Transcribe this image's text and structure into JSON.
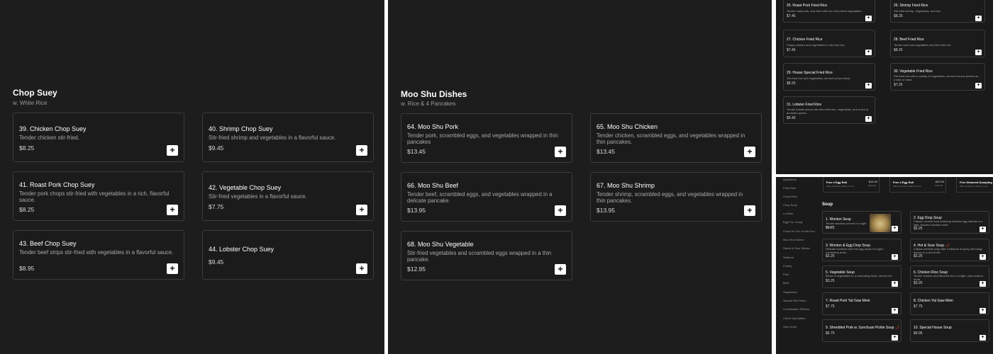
{
  "chop_suey": {
    "title": "Chop Suey",
    "subtitle": "w. White Rice",
    "items": [
      {
        "name": "39. Chicken Chop Suey",
        "desc": "Tender chicken stir-fried.",
        "price": "$8.25"
      },
      {
        "name": "40. Shrimp Chop Suey",
        "desc": "Stir-fried shrimp and vegetables in a flavorful sauce.",
        "price": "$9.45"
      },
      {
        "name": "41. Roast Pork Chop Suey",
        "desc": "Tender pork chops stir-fried with vegetables in a rich, flavorful sauce.",
        "price": "$8.25"
      },
      {
        "name": "42. Vegetable Chop Suey",
        "desc": "Stir-fried vegetables in a flavorful sauce.",
        "price": "$7.75"
      },
      {
        "name": "43. Beef Chop Suey",
        "desc": "Tender beef strips stir-fried with vegetables in a flavorful sauce.",
        "price": "$8.95"
      },
      {
        "name": "44. Lobster Chop Suey",
        "desc": "",
        "price": "$9.45"
      }
    ]
  },
  "moo_shu": {
    "title": "Moo Shu Dishes",
    "subtitle": "w. Rice & 4 Pancakes",
    "items": [
      {
        "name": "64. Moo Shu Pork",
        "desc": "Tender pork, scrambled eggs, and vegetables wrapped in thin pancakes",
        "price": "$13.45"
      },
      {
        "name": "65. Moo Shu Chicken",
        "desc": "Tender chicken, scrambled eggs, and vegetables wrapped in thin pancakes.",
        "price": "$13.45"
      },
      {
        "name": "66. Moo Shu Beef",
        "desc": "Tender beef, scrambled eggs, and vegetables wrapped in a delicate pancake.",
        "price": "$13.95"
      },
      {
        "name": "67. Moo Shu Shrimp",
        "desc": "Tender shrimp, scrambled eggs, and vegetables wrapped in thin pancakes.",
        "price": "$13.95"
      },
      {
        "name": "68. Moo Shu Vegetable",
        "desc": "Stir-fried vegetables and scrambled eggs wrapped in a thin pancake.",
        "price": "$12.95"
      }
    ]
  },
  "fried_rice": {
    "items": [
      {
        "name": "25. Roast Pork Fried Rice",
        "desc": "Tender roast pork, wok-fried with rice and mixed vegetables.",
        "price": "$7.45"
      },
      {
        "name": "26. Shrimp Fried Rice",
        "desc": "Stir-fried shrimp, vegetables, and rice",
        "price": "$8.25"
      },
      {
        "name": "27. Chicken Fried Rice",
        "desc": "Crispy chicken and vegetables in stir-fried rice.",
        "price": "$7.45"
      },
      {
        "name": "28. Beef Fried Rice",
        "desc": "Tender beef and vegetables stir-fried with rice",
        "price": "$8.25"
      },
      {
        "name": "29. House Special Fried Rice",
        "desc": "Stir-fried rice and vegetables, served hot and fresh.",
        "price": "$8.25"
      },
      {
        "name": "30. Vegetable Fried Rice",
        "desc": "Stir-fried rice with a variety of vegetables, served hot and perfect as a side or meal.",
        "price": "$7.25"
      },
      {
        "name": "31. Lobster Fried Rice",
        "desc": "Tender lobster pieces stir-fried with rice, vegetables, and a hint of aromatic spices.",
        "price": "$9.45"
      }
    ]
  },
  "soup_page": {
    "sidebar": [
      "Appetizers",
      "Fried Rice",
      "Chow Mein",
      "Chop Suey",
      "Lo Mein",
      "Egg Foo Young",
      "Chow Ho Fun or Mei Fun",
      "Moo Shu Dishes",
      "Sweet & Sour Dishes",
      "Seafood",
      "Poultry",
      "Pork",
      "Beef",
      "Vegetables",
      "Special Diet Menu",
      "Combination Platters",
      "Chef's Specialties",
      "Side Order"
    ],
    "promos": [
      {
        "title": "Free 4 Egg Roll",
        "sub": "With purchase of $25 or more",
        "price": "$15.00",
        "price_sub": "Subtotal"
      },
      {
        "title": "Free 4 Egg Roll",
        "sub": "With purchase of $25 or more",
        "price": "$20.00",
        "price_sub": "Subtotal"
      },
      {
        "title": "Free Steamed Dumpling",
        "sub": "With purchase of $40 or more",
        "price": "$40.00",
        "price_sub": "Subtotal"
      }
    ],
    "title": "Soup",
    "items": [
      {
        "name": "1. Wonton Soup",
        "desc": "Tender wontons served in a light broth.",
        "price": "$3.25",
        "spicy": ""
      },
      {
        "name": "2. Egg Drop Soup",
        "desc": "Classic comfort food featuring delicate egg strands in a light, flavorful chicken broth.",
        "price": "$3.25",
        "spicy": ""
      },
      {
        "name": "3. Wonton & Egg Drop Soup",
        "desc": "Delicate wontons and thin egg drops in a light, comforting broth.",
        "price": "$3.25",
        "spicy": ""
      },
      {
        "name": "4. Hot & Sour Soup",
        "desc": "Classic comfort soup with a balance of spicy and tangy flavors in a rich broth.",
        "price": "$3.25",
        "spicy": "🌶"
      },
      {
        "name": "5. Vegetable Soup",
        "desc": "Blend of vegetables in a comforting broth, served hot.",
        "price": "$3.25",
        "spicy": ""
      },
      {
        "name": "6. Chicken Rice Soup",
        "desc": "Tender chicken and flavorful rice in a light, slow-cooked broth.",
        "price": "$3.25",
        "spicy": ""
      },
      {
        "name": "7. Roast Pork Yat Gaw Mein",
        "desc": "",
        "price": "$7.75",
        "spicy": ""
      },
      {
        "name": "8. Chicken Yat Gaw Mein",
        "desc": "",
        "price": "$7.75",
        "spicy": ""
      },
      {
        "name": "9. Shredded Pork w. Szechuan Pickle Soup",
        "desc": "",
        "price": "$6.75",
        "spicy": "🌶"
      },
      {
        "name": "10. Special House Soup",
        "desc": "",
        "price": "$9.95",
        "spicy": ""
      }
    ]
  },
  "icons": {
    "add": "+",
    "add_icon_name": "plus-icon"
  },
  "colors": {
    "background": "#1d1d1d",
    "card_border": "#3c3c3c",
    "button": "#ffffff",
    "spicy": "#e0402a"
  }
}
